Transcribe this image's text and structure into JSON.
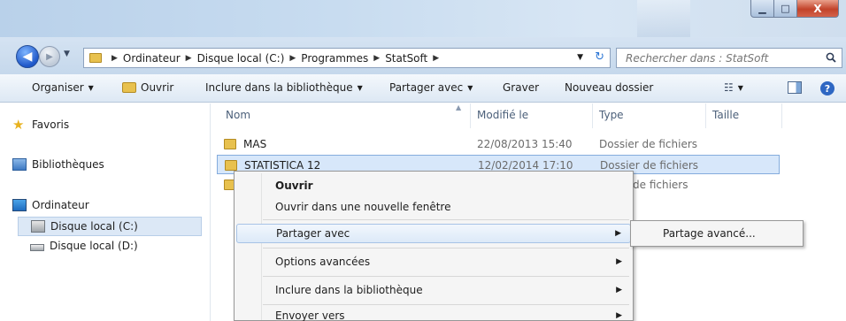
{
  "window": {
    "controls": {
      "minimize": "▁",
      "maximize": "□",
      "close": "X"
    }
  },
  "address": {
    "crumbs": [
      "Ordinateur",
      "Disque local (C:)",
      "Programmes",
      "StatSoft"
    ],
    "separator": "▶"
  },
  "search": {
    "placeholder": "Rechercher dans : StatSoft"
  },
  "toolbar": {
    "organize": "Organiser",
    "open": "Ouvrir",
    "include_library": "Inclure dans la bibliothèque",
    "share_with": "Partager avec",
    "burn": "Graver",
    "new_folder": "Nouveau dossier",
    "caret": "▼"
  },
  "navpane": {
    "favorites": "Favoris",
    "libraries": "Bibliothèques",
    "computer": "Ordinateur",
    "drive_c": "Disque local (C:)",
    "drive_d": "Disque local (D:)"
  },
  "columns": {
    "name": "Nom",
    "modified": "Modifié le",
    "type": "Type",
    "size": "Taille"
  },
  "files": [
    {
      "name": "MAS",
      "modified": "22/08/2013 15:40",
      "type": "Dossier de fichiers"
    },
    {
      "name": "STATISTICA 12",
      "modified": "12/02/2014 17:10",
      "type": "Dossier de fichiers"
    },
    {
      "name": "",
      "modified": "",
      "type": "de fichiers"
    }
  ],
  "context_menu": {
    "open": "Ouvrir",
    "open_new_window": "Ouvrir dans une nouvelle fenêtre",
    "share_with": "Partager avec",
    "advanced_options": "Options avancées",
    "include_library": "Inclure dans la bibliothèque",
    "send_to": "Envoyer vers",
    "arrow": "▶"
  },
  "submenu": {
    "advanced_sharing": "Partage avancé..."
  },
  "colors": {
    "selection": "#d7e7fa",
    "selection_border": "#84acdd",
    "accent": "#2e67c3"
  }
}
